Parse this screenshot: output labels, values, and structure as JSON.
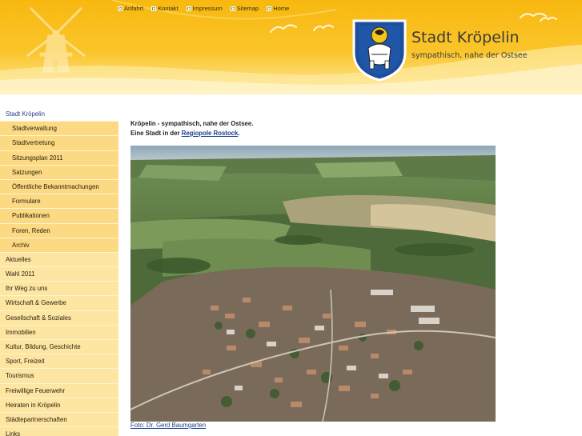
{
  "header": {
    "topnav": [
      {
        "label": "Anfahrt"
      },
      {
        "label": "Kontakt"
      },
      {
        "label": "Impressum"
      },
      {
        "label": "Sitemap"
      },
      {
        "label": "Home"
      }
    ],
    "title": "Stadt Kröpelin",
    "tagline": "sympathisch, nahe der Ostsee"
  },
  "sidebar": {
    "items": [
      {
        "label": "Stadt Kröpelin"
      },
      {
        "label": "Stadtverwaltung"
      },
      {
        "label": "Stadtvertretung"
      },
      {
        "label": "Sitzungsplan 2011"
      },
      {
        "label": "Satzungen"
      },
      {
        "label": "Öffentliche Bekanntmachungen"
      },
      {
        "label": "Formulare"
      },
      {
        "label": "Publikationen"
      },
      {
        "label": "Foren, Reden"
      },
      {
        "label": "Archiv"
      },
      {
        "label": "Aktuelles"
      },
      {
        "label": "Wahl 2011"
      },
      {
        "label": "Ihr Weg zu uns"
      },
      {
        "label": "Wirtschaft & Gewerbe"
      },
      {
        "label": "Gesellschaft & Soziales"
      },
      {
        "label": "Immobilien"
      },
      {
        "label": "Kultur, Bildung, Geschichte"
      },
      {
        "label": "Sport, Freizeit"
      },
      {
        "label": "Tourismus"
      },
      {
        "label": "Freiwillige Feuerwehr"
      },
      {
        "label": "Heiraten in Kröpelin"
      },
      {
        "label": "Städtepartnerschaften"
      },
      {
        "label": "Links"
      }
    ]
  },
  "main": {
    "intro_line1": "Kröpelin - sympathisch, nahe der Ostsee.",
    "intro_line2_prefix": "Eine Stadt in der",
    "intro_link": "Regiopole Rostock",
    "intro_line2_suffix": ".",
    "photo_caption": "Foto: Dr. Gerd Baumgarten"
  },
  "colors": {
    "header_yellow": "#f8b810",
    "sidebar_bg": "#fde49a",
    "sidebar_sub_bg": "#fcd983",
    "link_blue": "#1a3e8a",
    "shield_blue": "#1d4f9c"
  },
  "icons": {
    "topnav_bullet": "arrow-right-icon",
    "windmill": "windmill-icon",
    "coat_of_arms": "coat-of-arms-icon",
    "birds": "seagull-icon"
  }
}
